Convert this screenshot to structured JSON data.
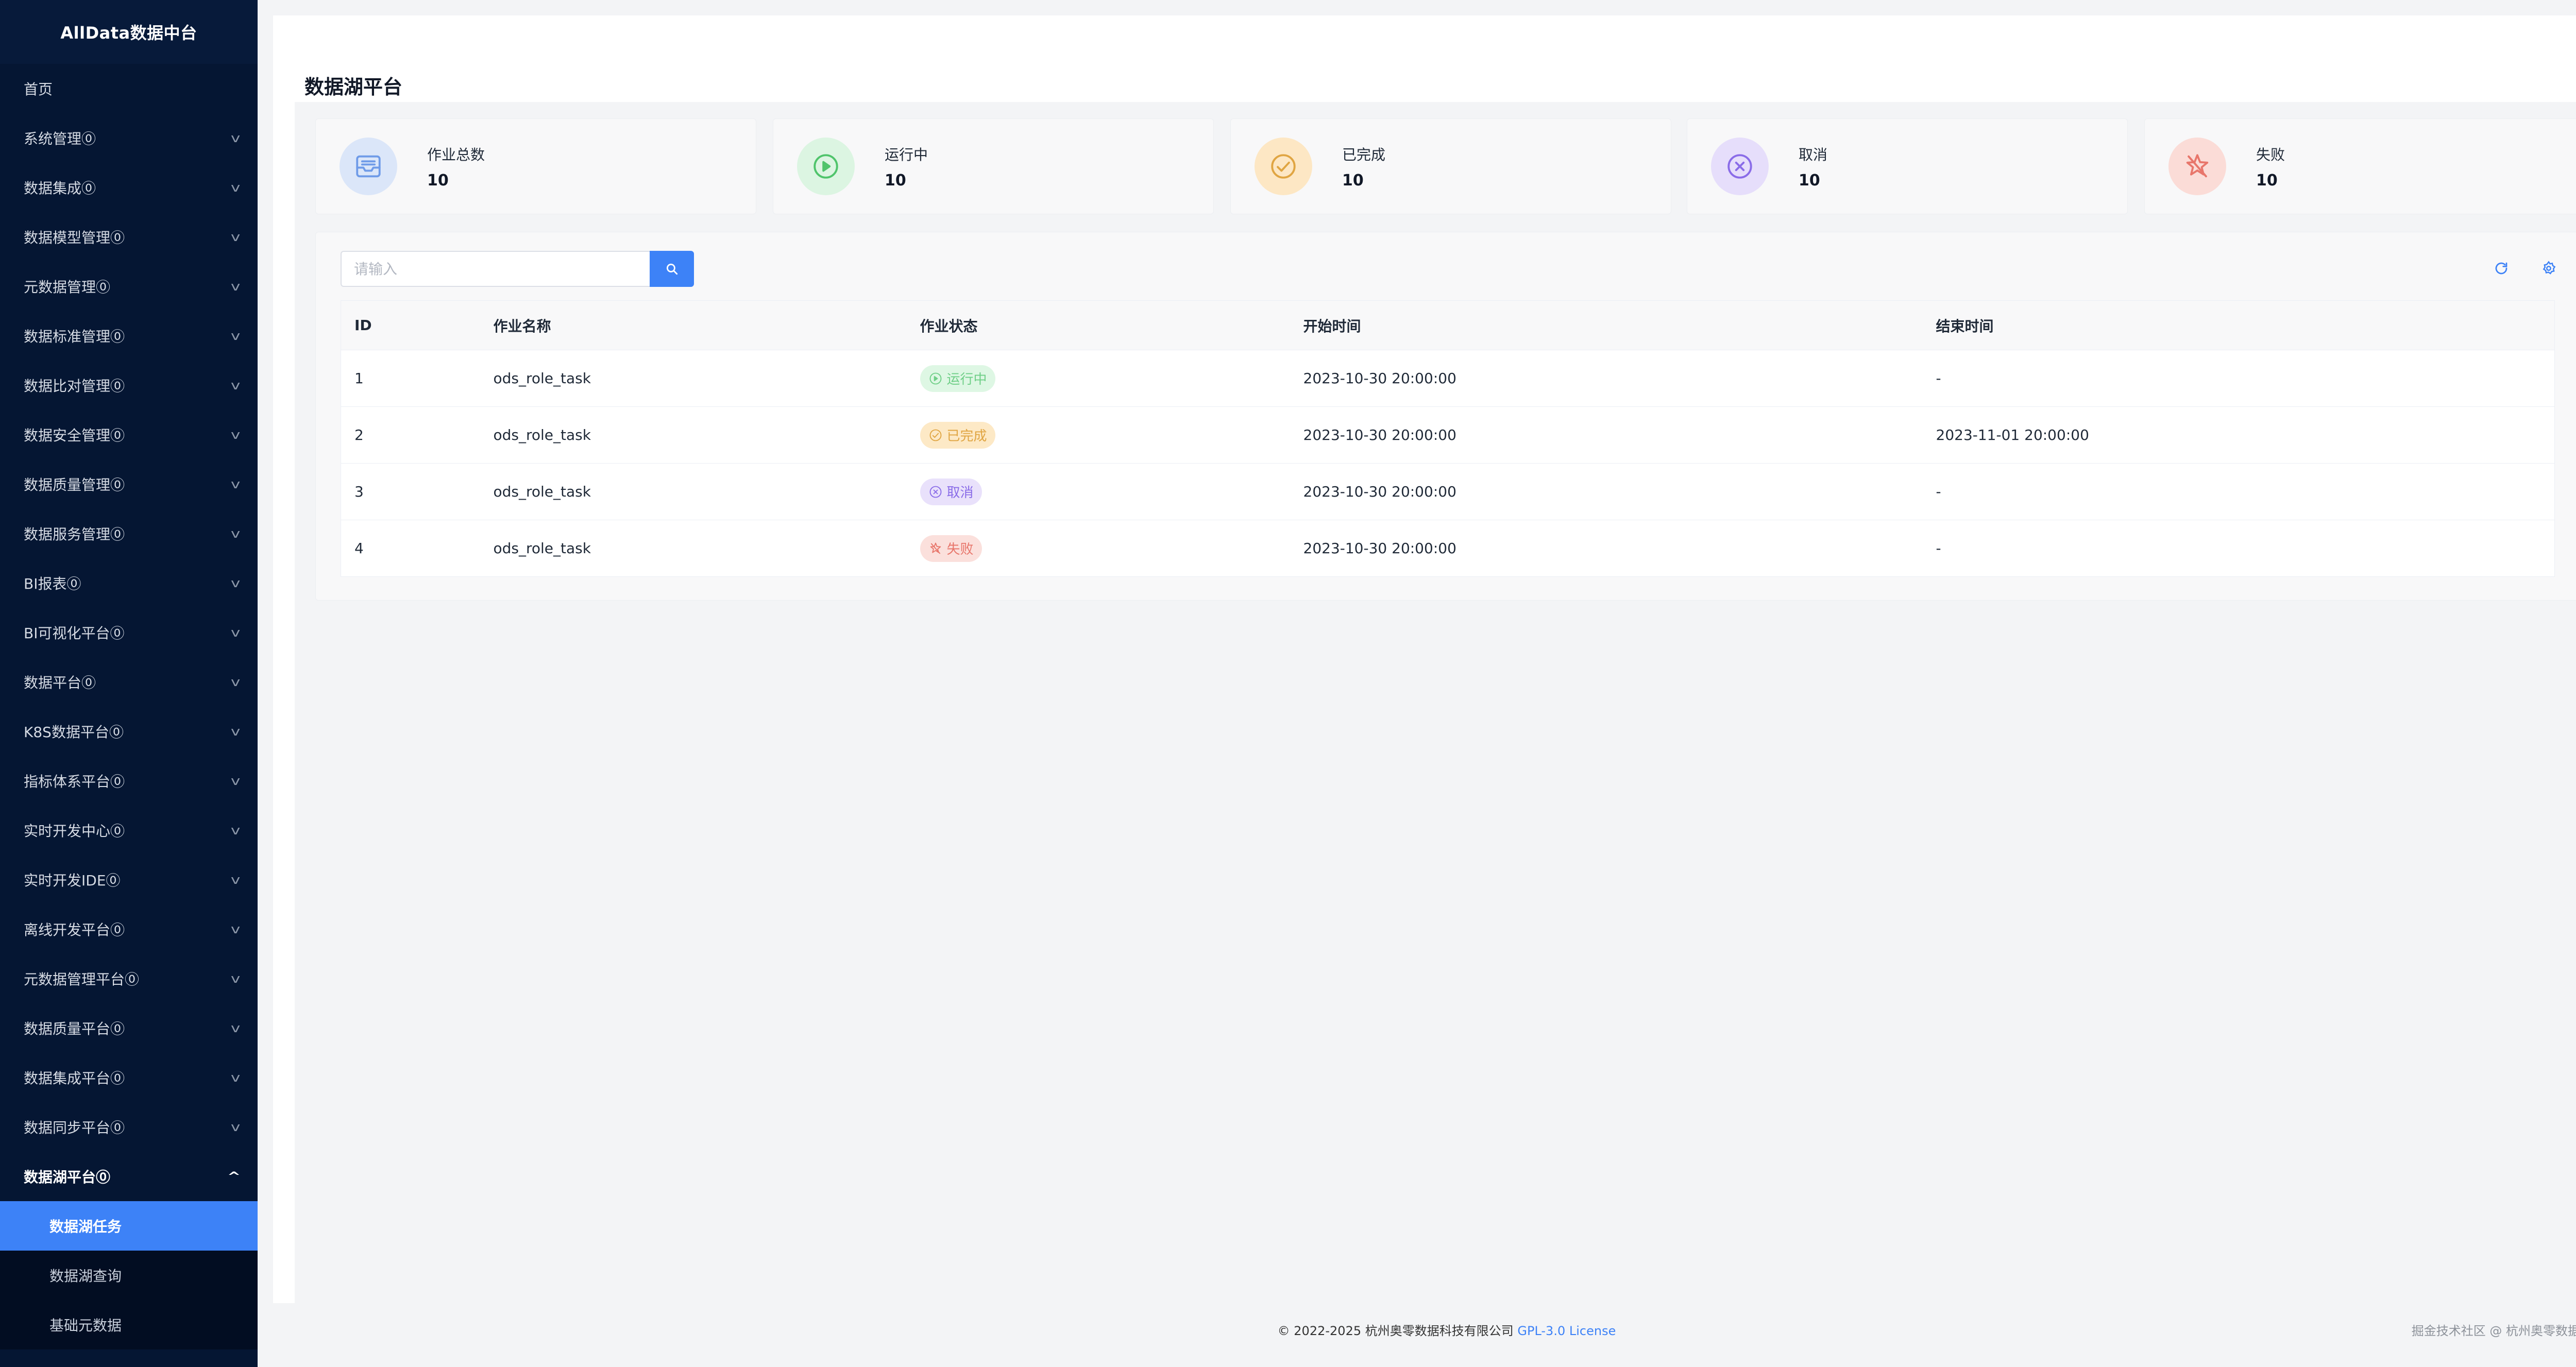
{
  "sidebar": {
    "brand": "AllData数据中台",
    "items": [
      {
        "label": "首页",
        "has_children": false
      },
      {
        "label": "系统管理⓪",
        "has_children": true
      },
      {
        "label": "数据集成⓪",
        "has_children": true
      },
      {
        "label": "数据模型管理⓪",
        "has_children": true
      },
      {
        "label": "元数据管理⓪",
        "has_children": true
      },
      {
        "label": "数据标准管理⓪",
        "has_children": true
      },
      {
        "label": "数据比对管理⓪",
        "has_children": true
      },
      {
        "label": "数据安全管理⓪",
        "has_children": true
      },
      {
        "label": "数据质量管理⓪",
        "has_children": true
      },
      {
        "label": "数据服务管理⓪",
        "has_children": true
      },
      {
        "label": "BI报表⓪",
        "has_children": true
      },
      {
        "label": "BI可视化平台⓪",
        "has_children": true
      },
      {
        "label": "数据平台⓪",
        "has_children": true
      },
      {
        "label": "K8S数据平台⓪",
        "has_children": true
      },
      {
        "label": "指标体系平台⓪",
        "has_children": true
      },
      {
        "label": "实时开发中心⓪",
        "has_children": true
      },
      {
        "label": "实时开发IDE⓪",
        "has_children": true
      },
      {
        "label": "离线开发平台⓪",
        "has_children": true
      },
      {
        "label": "元数据管理平台⓪",
        "has_children": true
      },
      {
        "label": "数据质量平台⓪",
        "has_children": true
      },
      {
        "label": "数据集成平台⓪",
        "has_children": true
      },
      {
        "label": "数据同步平台⓪",
        "has_children": true
      }
    ],
    "expanded": {
      "label": "数据湖平台⓪",
      "children": [
        {
          "label": "数据湖任务",
          "active": true
        },
        {
          "label": "数据湖查询",
          "active": false
        },
        {
          "label": "基础元数据",
          "active": false
        }
      ]
    }
  },
  "page": {
    "title": "数据湖平台"
  },
  "stats": [
    {
      "label": "作业总数",
      "value": "10",
      "icon": "inbox-icon",
      "bg": "#dbe6f9",
      "fg": "#6f9be8"
    },
    {
      "label": "运行中",
      "value": "10",
      "icon": "play-circle-icon",
      "bg": "#dcf5e2",
      "fg": "#4fc46b"
    },
    {
      "label": "已完成",
      "value": "10",
      "icon": "check-circle-icon",
      "bg": "#fde7c4",
      "fg": "#e0a542"
    },
    {
      "label": "取消",
      "value": "10",
      "icon": "x-circle-icon",
      "bg": "#e6defb",
      "fg": "#8a6ce8"
    },
    {
      "label": "失败",
      "value": "10",
      "icon": "broken-star-icon",
      "bg": "#fbdcd7",
      "fg": "#e8766b"
    }
  ],
  "search": {
    "placeholder": "请输入"
  },
  "table": {
    "columns": [
      "ID",
      "作业名称",
      "作业状态",
      "开始时间",
      "结束时间"
    ],
    "rows": [
      {
        "id": "1",
        "name": "ods_role_task",
        "status": "运行中",
        "status_key": "running",
        "start": "2023-10-30 20:00:00",
        "end": "-"
      },
      {
        "id": "2",
        "name": "ods_role_task",
        "status": "已完成",
        "status_key": "done",
        "start": "2023-10-30 20:00:00",
        "end": "2023-11-01 20:00:00"
      },
      {
        "id": "3",
        "name": "ods_role_task",
        "status": "取消",
        "status_key": "cancel",
        "start": "2023-10-30 20:00:00",
        "end": "-"
      },
      {
        "id": "4",
        "name": "ods_role_task",
        "status": "失败",
        "status_key": "failed",
        "start": "2023-10-30 20:00:00",
        "end": "-"
      }
    ]
  },
  "status_styles": {
    "running": {
      "bg": "#def7e4",
      "fg": "#6fcf87"
    },
    "done": {
      "bg": "#fde9c6",
      "fg": "#e0a542"
    },
    "cancel": {
      "bg": "#e9e1fb",
      "fg": "#8a6ce8"
    },
    "failed": {
      "bg": "#fbe0dc",
      "fg": "#e8766b"
    }
  },
  "footer": {
    "copyright": "© 2022-2025 杭州奥零数据科技有限公司",
    "license": "GPL-3.0 License",
    "watermark": "掘金技术社区 @ 杭州奥零数据科技"
  },
  "colors": {
    "sidebar_bg": "#051633",
    "primary": "#3d82f7"
  }
}
